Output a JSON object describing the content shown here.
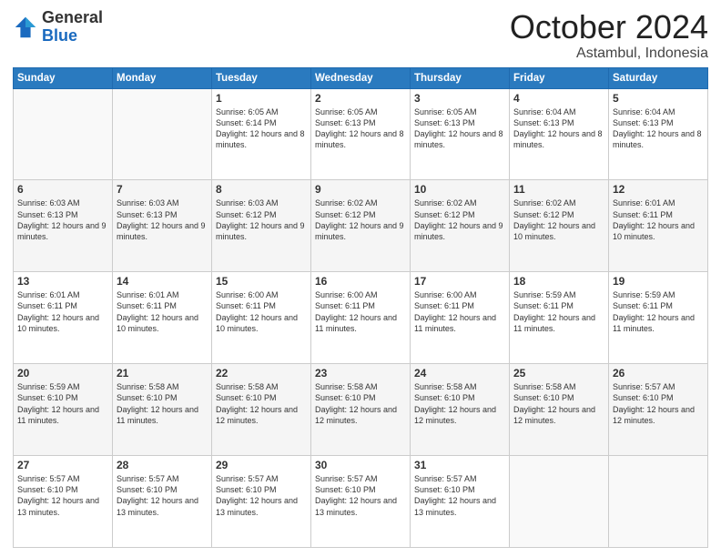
{
  "header": {
    "logo_general": "General",
    "logo_blue": "Blue",
    "month_title": "October 2024",
    "subtitle": "Astambul, Indonesia"
  },
  "weekdays": [
    "Sunday",
    "Monday",
    "Tuesday",
    "Wednesday",
    "Thursday",
    "Friday",
    "Saturday"
  ],
  "weeks": [
    [
      {
        "day": "",
        "info": ""
      },
      {
        "day": "",
        "info": ""
      },
      {
        "day": "1",
        "info": "Sunrise: 6:05 AM\nSunset: 6:14 PM\nDaylight: 12 hours and 8 minutes."
      },
      {
        "day": "2",
        "info": "Sunrise: 6:05 AM\nSunset: 6:13 PM\nDaylight: 12 hours and 8 minutes."
      },
      {
        "day": "3",
        "info": "Sunrise: 6:05 AM\nSunset: 6:13 PM\nDaylight: 12 hours and 8 minutes."
      },
      {
        "day": "4",
        "info": "Sunrise: 6:04 AM\nSunset: 6:13 PM\nDaylight: 12 hours and 8 minutes."
      },
      {
        "day": "5",
        "info": "Sunrise: 6:04 AM\nSunset: 6:13 PM\nDaylight: 12 hours and 8 minutes."
      }
    ],
    [
      {
        "day": "6",
        "info": "Sunrise: 6:03 AM\nSunset: 6:13 PM\nDaylight: 12 hours and 9 minutes."
      },
      {
        "day": "7",
        "info": "Sunrise: 6:03 AM\nSunset: 6:13 PM\nDaylight: 12 hours and 9 minutes."
      },
      {
        "day": "8",
        "info": "Sunrise: 6:03 AM\nSunset: 6:12 PM\nDaylight: 12 hours and 9 minutes."
      },
      {
        "day": "9",
        "info": "Sunrise: 6:02 AM\nSunset: 6:12 PM\nDaylight: 12 hours and 9 minutes."
      },
      {
        "day": "10",
        "info": "Sunrise: 6:02 AM\nSunset: 6:12 PM\nDaylight: 12 hours and 9 minutes."
      },
      {
        "day": "11",
        "info": "Sunrise: 6:02 AM\nSunset: 6:12 PM\nDaylight: 12 hours and 10 minutes."
      },
      {
        "day": "12",
        "info": "Sunrise: 6:01 AM\nSunset: 6:11 PM\nDaylight: 12 hours and 10 minutes."
      }
    ],
    [
      {
        "day": "13",
        "info": "Sunrise: 6:01 AM\nSunset: 6:11 PM\nDaylight: 12 hours and 10 minutes."
      },
      {
        "day": "14",
        "info": "Sunrise: 6:01 AM\nSunset: 6:11 PM\nDaylight: 12 hours and 10 minutes."
      },
      {
        "day": "15",
        "info": "Sunrise: 6:00 AM\nSunset: 6:11 PM\nDaylight: 12 hours and 10 minutes."
      },
      {
        "day": "16",
        "info": "Sunrise: 6:00 AM\nSunset: 6:11 PM\nDaylight: 12 hours and 11 minutes."
      },
      {
        "day": "17",
        "info": "Sunrise: 6:00 AM\nSunset: 6:11 PM\nDaylight: 12 hours and 11 minutes."
      },
      {
        "day": "18",
        "info": "Sunrise: 5:59 AM\nSunset: 6:11 PM\nDaylight: 12 hours and 11 minutes."
      },
      {
        "day": "19",
        "info": "Sunrise: 5:59 AM\nSunset: 6:11 PM\nDaylight: 12 hours and 11 minutes."
      }
    ],
    [
      {
        "day": "20",
        "info": "Sunrise: 5:59 AM\nSunset: 6:10 PM\nDaylight: 12 hours and 11 minutes."
      },
      {
        "day": "21",
        "info": "Sunrise: 5:58 AM\nSunset: 6:10 PM\nDaylight: 12 hours and 11 minutes."
      },
      {
        "day": "22",
        "info": "Sunrise: 5:58 AM\nSunset: 6:10 PM\nDaylight: 12 hours and 12 minutes."
      },
      {
        "day": "23",
        "info": "Sunrise: 5:58 AM\nSunset: 6:10 PM\nDaylight: 12 hours and 12 minutes."
      },
      {
        "day": "24",
        "info": "Sunrise: 5:58 AM\nSunset: 6:10 PM\nDaylight: 12 hours and 12 minutes."
      },
      {
        "day": "25",
        "info": "Sunrise: 5:58 AM\nSunset: 6:10 PM\nDaylight: 12 hours and 12 minutes."
      },
      {
        "day": "26",
        "info": "Sunrise: 5:57 AM\nSunset: 6:10 PM\nDaylight: 12 hours and 12 minutes."
      }
    ],
    [
      {
        "day": "27",
        "info": "Sunrise: 5:57 AM\nSunset: 6:10 PM\nDaylight: 12 hours and 13 minutes."
      },
      {
        "day": "28",
        "info": "Sunrise: 5:57 AM\nSunset: 6:10 PM\nDaylight: 12 hours and 13 minutes."
      },
      {
        "day": "29",
        "info": "Sunrise: 5:57 AM\nSunset: 6:10 PM\nDaylight: 12 hours and 13 minutes."
      },
      {
        "day": "30",
        "info": "Sunrise: 5:57 AM\nSunset: 6:10 PM\nDaylight: 12 hours and 13 minutes."
      },
      {
        "day": "31",
        "info": "Sunrise: 5:57 AM\nSunset: 6:10 PM\nDaylight: 12 hours and 13 minutes."
      },
      {
        "day": "",
        "info": ""
      },
      {
        "day": "",
        "info": ""
      }
    ]
  ]
}
